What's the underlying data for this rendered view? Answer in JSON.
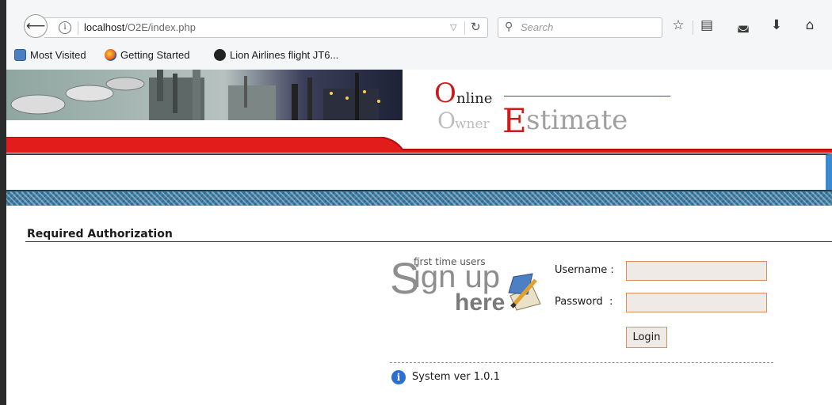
{
  "browser": {
    "url_host": "localhost",
    "url_path": "/O2E/index.php",
    "search_placeholder": "Search",
    "bookmarks": [
      {
        "label": "Most Visited",
        "icon": "most-visited-icon"
      },
      {
        "label": "Getting Started",
        "icon": "firefox-icon"
      },
      {
        "label": "Lion Airlines flight JT6...",
        "icon": "bookmark-page-icon"
      }
    ],
    "icons": [
      "back-icon",
      "info-icon",
      "reload-icon",
      "search-icon",
      "star-icon",
      "reading-list-icon",
      "pocket-icon",
      "download-icon",
      "home-icon"
    ]
  },
  "logo": {
    "online_initial": "O",
    "online_rest": "nline",
    "owner_initial": "O",
    "owner_rest": "wner",
    "estimate_initial": "E",
    "estimate_rest": "stimate"
  },
  "auth": {
    "title": "Required Authorization",
    "signup": {
      "big_s": "S",
      "first_time": "first time users",
      "ign_up": "ign up",
      "here": "here"
    },
    "username_label": "Username :",
    "password_label": "Password  :",
    "username_value": "",
    "password_value": "",
    "login_label": "Login",
    "system_version": "System ver 1.0.1"
  },
  "colors": {
    "brand_red": "#cc1b1b",
    "input_border": "#d9905c",
    "input_bg": "#efeae6",
    "pattern_blue": "#3d7ea6"
  }
}
